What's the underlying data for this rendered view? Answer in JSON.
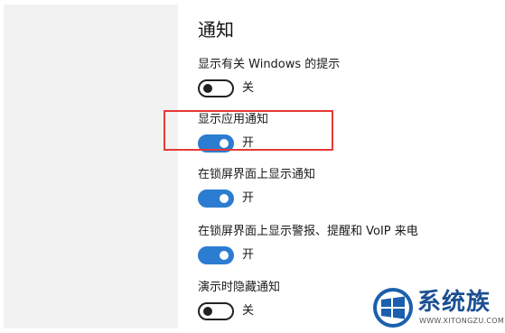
{
  "sidebar": {},
  "main": {
    "title": "通知",
    "settings": [
      {
        "label": "显示有关 Windows 的提示",
        "state": "off",
        "state_label": "关"
      },
      {
        "label": "显示应用通知",
        "state": "on",
        "state_label": "开"
      },
      {
        "label": "在锁屏界面上显示通知",
        "state": "on",
        "state_label": "开"
      },
      {
        "label": "在锁屏界面上显示警报、提醒和 VoIP 来电",
        "state": "on",
        "state_label": "开"
      },
      {
        "label": "演示时隐藏通知",
        "state": "off",
        "state_label": "关"
      }
    ]
  },
  "annotation": {
    "highlight_color": "#e53935"
  },
  "watermark": {
    "brand_cn": "系统族",
    "brand_en": "WWW.XITONGZU.COM"
  },
  "colors": {
    "toggle_on": "#2c7cd1",
    "toggle_off": "#222222",
    "sidebar_bg": "#f2f2f2"
  }
}
